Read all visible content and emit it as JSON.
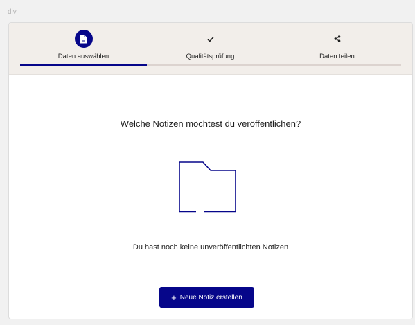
{
  "breadcrumb": "div",
  "stepper": {
    "steps": [
      {
        "label": "Daten auswählen",
        "icon": "document-icon",
        "active": true
      },
      {
        "label": "Qualitätsprüfung",
        "icon": "check-icon",
        "active": false
      },
      {
        "label": "Daten teilen",
        "icon": "share-icon",
        "active": false
      }
    ],
    "progress_fraction": 0.333
  },
  "main": {
    "question": "Welche Notizen möchtest du veröffentlichen?",
    "empty_message": "Du hast noch keine unveröffentlichten Notizen",
    "empty_icon": "folder-icon",
    "new_button": {
      "icon": "+",
      "label": "Neue Notiz erstellen"
    }
  },
  "colors": {
    "accent": "#06068a",
    "stepper_bg": "#f2eeea",
    "track": "#dcd3cf"
  }
}
